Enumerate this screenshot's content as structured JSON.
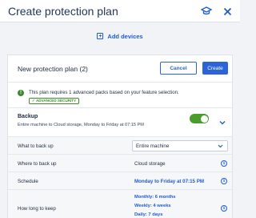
{
  "header": {
    "title": "Create protection plan",
    "icons": [
      "graduation-cap-icon",
      "close-icon"
    ]
  },
  "add_devices": {
    "label": "Add devices",
    "icon": "plus-square-icon"
  },
  "plan": {
    "title": "New protection plan (2)",
    "cancel_label": "Cancel",
    "create_label": "Create",
    "notice": "This plan requires 1 advanced packs based on your feature selection.",
    "badge": "✓ ADVANCED SECURITY",
    "colors": {
      "primary": "#2b63d9",
      "success": "#3d8b2c"
    }
  },
  "backup": {
    "label": "Backup",
    "description": "Entire machine to Cloud storage, Monday to Friday at 07:15 PM",
    "enabled": true
  },
  "settings": {
    "what_label": "What to back up",
    "what_value": "Entire machine",
    "where_label": "Where to back up",
    "where_value": "Cloud storage",
    "schedule_label": "Schedule",
    "schedule_value": "Monday to Friday at 07:15 PM",
    "keep_label": "How long to keep",
    "keep_monthly": "Monthly: 6 months",
    "keep_weekly": "Weekly: 4 weeks",
    "keep_daily": "Daily: 7 days"
  }
}
